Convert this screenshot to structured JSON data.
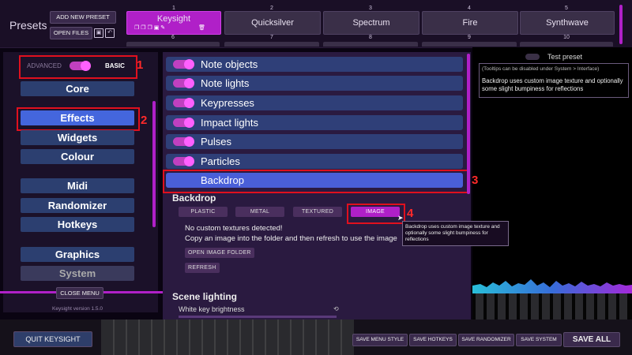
{
  "topbar": {
    "presets_title": "Presets",
    "add_new_preset": "ADD NEW PRESET",
    "open_files": "OPEN FILES",
    "presets": [
      {
        "number": "1",
        "name": "Keysight"
      },
      {
        "number": "2",
        "name": "Quicksilver"
      },
      {
        "number": "3",
        "name": "Spectrum"
      },
      {
        "number": "4",
        "name": "Fire"
      },
      {
        "number": "5",
        "name": "Synthwave"
      }
    ],
    "row2_numbers": [
      "6",
      "7",
      "8",
      "9",
      "10"
    ]
  },
  "sidebar": {
    "mode_advanced": "ADVANCED",
    "mode_basic": "BASIC",
    "items": [
      {
        "label": "Core"
      },
      {
        "label": "Effects"
      },
      {
        "label": "Widgets"
      },
      {
        "label": "Colour"
      },
      {
        "label": "Midi"
      },
      {
        "label": "Randomizer"
      },
      {
        "label": "Hotkeys"
      },
      {
        "label": "Graphics"
      },
      {
        "label": "System"
      }
    ],
    "close_menu": "CLOSE MENU",
    "version": "Keysight version 1.5.0"
  },
  "annotations": [
    "1",
    "2",
    "3",
    "4"
  ],
  "main": {
    "rows": [
      {
        "label": "Note objects"
      },
      {
        "label": "Note lights"
      },
      {
        "label": "Keypresses"
      },
      {
        "label": "Impact lights"
      },
      {
        "label": "Pulses"
      },
      {
        "label": "Particles"
      }
    ],
    "backdrop_row": "Backdrop",
    "backdrop_heading": "Backdrop",
    "textures": [
      "PLASTIC",
      "METAL",
      "TEXTURED",
      "IMAGE"
    ],
    "no_textures": "No custom textures detected!",
    "copy_image": "Copy an image into the folder and then refresh to use the image",
    "open_image_folder": "OPEN IMAGE FOLDER",
    "refresh": "REFRESH",
    "tooltip": "Backdrop uses custom image texture and optionally some slight bumpiness for reflections",
    "scene_lighting": "Scene lighting",
    "white_key_brightness": "White key brightness"
  },
  "right": {
    "test_preset": "Test preset",
    "tooltips_note": "(Tooltips can be disabled under System > Interface)",
    "description": "Backdrop uses custom image texture and optionally some slight bumpiness for reflections"
  },
  "bottombar": {
    "quit": "QUIT KEYSIGHT",
    "save_menu_style": "SAVE MENU STYLE",
    "save_hotkeys": "SAVE HOTKEYS",
    "save_randomizer": "SAVE RANDOMIZER",
    "save_system": "SAVE SYSTEM",
    "save_all": "SAVE ALL"
  },
  "colors": {
    "accent": "#b020c8",
    "highlight_box": "#e0101e",
    "row_blue": "#2f3f78",
    "active_blue": "#4466dd"
  }
}
